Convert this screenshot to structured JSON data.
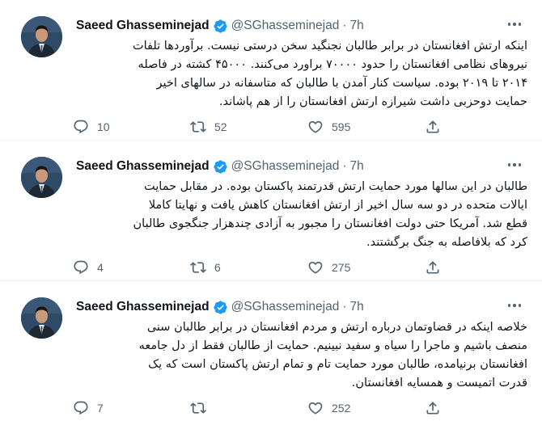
{
  "colors": {
    "verified": "#1d9bf0",
    "text": "#0f1419",
    "muted": "#536471",
    "divider": "#eff3f4"
  },
  "tweets": [
    {
      "author": "Saeed Ghasseminejad",
      "handle": "@SGhasseminejad",
      "separator": "·",
      "time": "7h",
      "lines": [
        "اینکه ارتش افغانستان در برابر طالبان نجنگید سخن درستی نیست. برآوردها تلفات",
        "نیروهای نظامی افغانستان را حدود ۷۰۰۰۰ براورد می‌کنند. ۴۵۰۰۰ کشته در فاصله",
        "۲۰۱۴ تا ۲۰۱۹ بوده. سیاست کنار آمدن با طالبان که متاسفانه در سالهای اخیر",
        "حمایت دوحزبی داشت شیرازه ارتش افغانستان را از هم پاشاند."
      ],
      "replies": "10",
      "retweets": "52",
      "likes": "595"
    },
    {
      "author": "Saeed Ghasseminejad",
      "handle": "@SGhasseminejad",
      "separator": "·",
      "time": "7h",
      "lines": [
        "طالبان در این سالها مورد حمایت ارتش قدرتمند پاکستان بوده. در مقابل حمایت",
        "ایالات متحده در دو سه سال اخیر  از ارتش افغانستان کاهش یافت و نهایتا کاملا",
        "قطع شد. آمریکا حتی دولت افغانستان را مجبور به آزادی چندهزار جنگجوی طالبان",
        "کرد که بلافاصله به جنگ برگشتند."
      ],
      "replies": "4",
      "retweets": "6",
      "likes": "275"
    },
    {
      "author": "Saeed Ghasseminejad",
      "handle": "@SGhasseminejad",
      "separator": "·",
      "time": "7h",
      "lines": [
        "خلاصه اینکه در قضاوتمان درباره ارتش و مردم افغانستان در برابر طالبان سنی",
        "منصف باشیم و ماجرا را سیاه و سفید نبینیم. حمایت از طالبان فقط از دل جامعه",
        "افغانستان برنیامده، طالبان مورد حمایت تام و تمام ارتش پاکستان است که یک",
        "قدرت اتمیست و همسایه افغانستان."
      ],
      "replies": "7",
      "retweets": "",
      "likes": "252"
    }
  ],
  "icons": {
    "reply": "reply-icon",
    "retweet": "retweet-icon",
    "like": "like-icon",
    "share": "share-icon",
    "verified": "verified-badge-icon",
    "more": "more-icon"
  }
}
